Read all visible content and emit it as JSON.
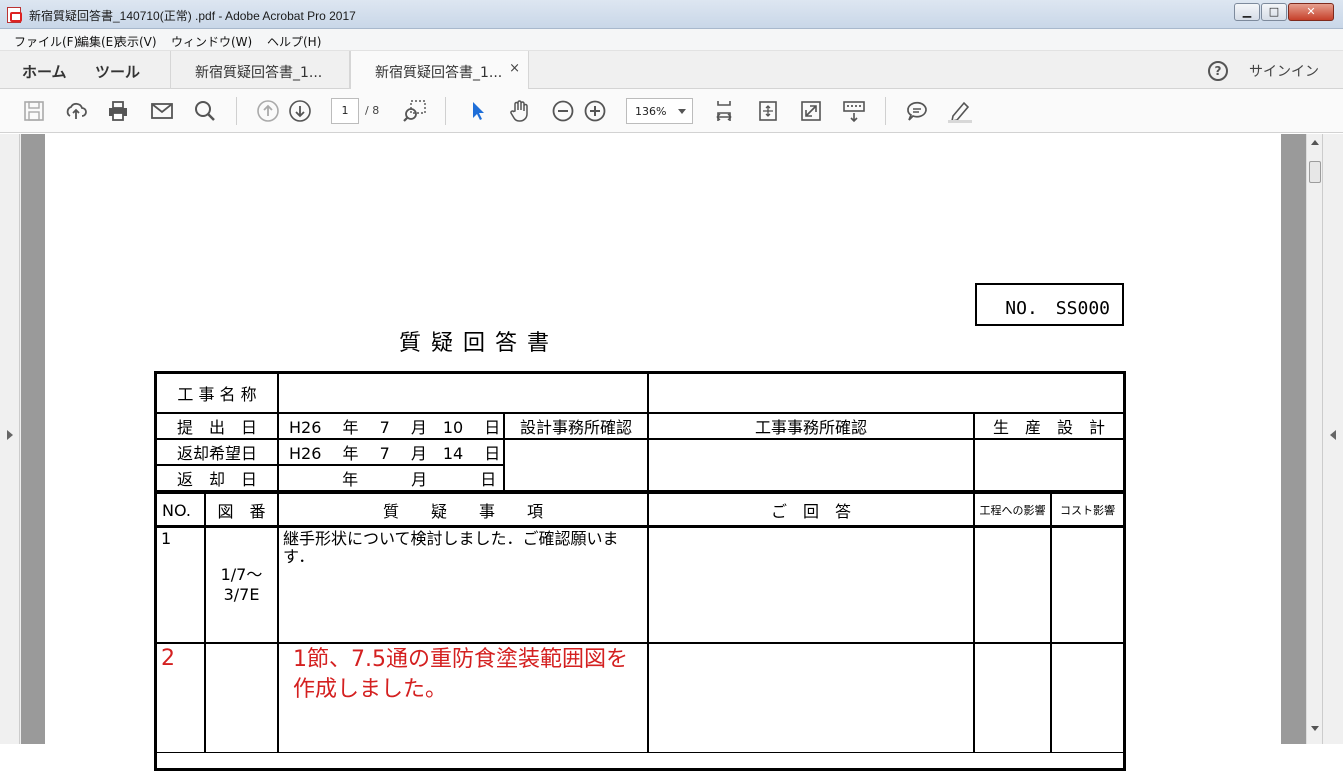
{
  "window": {
    "title": "新宿質疑回答書_140710(正常) .pdf - Adobe Acrobat Pro 2017",
    "minimize": "▁",
    "maximize": "□",
    "close": "✕"
  },
  "menu": [
    "ファイル(F)",
    "編集(E)",
    "表示(V)",
    "ウィンドウ(W)",
    "ヘルプ(H)"
  ],
  "tabs": {
    "home": "ホーム",
    "tools": "ツール",
    "doc1": "新宿質疑回答書_1...",
    "doc2": "新宿質疑回答書_1...",
    "close": "×",
    "signin": "サインイン",
    "help": "?"
  },
  "toolbar": {
    "page_current": "1",
    "page_total": "/ 8",
    "zoom": "136%",
    "icons": [
      "save-icon",
      "upload-icon",
      "print-icon",
      "email-icon",
      "search-icon",
      "prev-page-icon",
      "next-page-icon",
      "zoom-marquee-icon",
      "select-icon",
      "hand-icon",
      "zoom-out-icon",
      "zoom-in-icon",
      "fit-width-icon",
      "rotate-icon",
      "fullscreen-icon",
      "keyboard-icon",
      "comment-icon",
      "highlight-icon"
    ]
  },
  "document": {
    "number": "NO.　SS000",
    "title": "質疑回答書",
    "project_label": "工 事 名 称",
    "submit_label": "提　出　日",
    "submit_value": "H26　 年　 7　 月　10　 日",
    "return_hope_label": "返却希望日",
    "return_hope_value": "H26　 年　 7　 月　14　 日",
    "return_label": "返　却　日",
    "return_value": "　　　 年　　　 月　　　 日",
    "design_confirm": "設計事務所確認",
    "construction_confirm": "工事事務所確認",
    "production_design": "生　産　設　計",
    "col_no": "NO.",
    "col_drawing": "図　番",
    "col_question": "質　　疑　　事　　項",
    "col_answer": "ご　回　答",
    "col_process": "工程への影響",
    "col_cost": "コスト影響",
    "rows": [
      {
        "no": "1",
        "drawing": "1/7～\n3/7E",
        "question": "継手形状について検討しました．ご確認願います．"
      },
      {
        "no": "2",
        "drawing": "",
        "question": "1節、7.5通の重防食塗装範囲図を作成しました。"
      }
    ]
  }
}
